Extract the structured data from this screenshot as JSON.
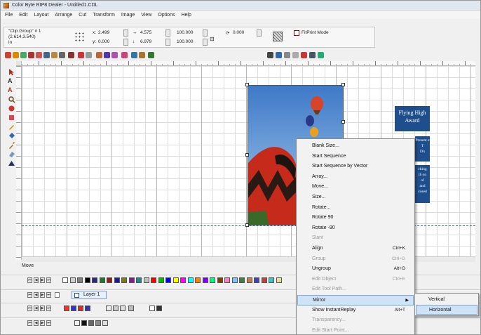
{
  "window": {
    "title": "Color Byte RIP8 Dealer - Untitled1.CDL"
  },
  "menu": [
    "File",
    "Edit",
    "Layout",
    "Arrange",
    "Cut",
    "Transform",
    "Image",
    "View",
    "Options",
    "Help"
  ],
  "properties": {
    "object_name": "\"Clip Group\" # 1",
    "coords": "(2.614,3.540)",
    "units": "in",
    "x_label": "x:",
    "x_value": "2.499",
    "y_label": "y:",
    "y_value": "0.000",
    "width_value": "4.575",
    "height_value": "6.979",
    "scale_w": "100.000",
    "scale_h": "100.000",
    "rotation": "0.000",
    "fitprint_label": "FitPrint Mode"
  },
  "status": {
    "text": "Move"
  },
  "layer": {
    "name": "Layer 1"
  },
  "award": {
    "title": "Flying High Award",
    "text_lines": [
      "Present e",
      "T",
      "D's",
      "cking",
      "th on",
      "of",
      "and",
      "cosed"
    ]
  },
  "context_menu": {
    "items": [
      {
        "label": "Blank Size...",
        "shortcut": "",
        "enabled": true
      },
      {
        "label": "Start Sequence",
        "shortcut": "",
        "enabled": true
      },
      {
        "label": "Start Sequence by Vector",
        "shortcut": "",
        "enabled": true
      },
      {
        "label": "Array...",
        "shortcut": "",
        "enabled": true
      },
      {
        "label": "Move...",
        "shortcut": "",
        "enabled": true
      },
      {
        "label": "Size...",
        "shortcut": "",
        "enabled": true
      },
      {
        "label": "Rotate...",
        "shortcut": "",
        "enabled": true
      },
      {
        "label": "Rotate 90",
        "shortcut": "",
        "enabled": true
      },
      {
        "label": "Rotate -90",
        "shortcut": "",
        "enabled": true
      },
      {
        "label": "Slant",
        "shortcut": "",
        "enabled": false
      },
      {
        "label": "Align",
        "shortcut": "Ctrl+K",
        "enabled": true
      },
      {
        "label": "Group",
        "shortcut": "Ctrl+G",
        "enabled": false
      },
      {
        "label": "Ungroup",
        "shortcut": "Alt+G",
        "enabled": true
      },
      {
        "label": "Edit Object",
        "shortcut": "Ctrl+E",
        "enabled": false
      },
      {
        "label": "Edit Tool Path...",
        "shortcut": "",
        "enabled": false
      },
      {
        "label": "Mirror",
        "shortcut": "",
        "enabled": true,
        "submenu": true,
        "highlighted": true
      },
      {
        "label": "Show InstantReplay",
        "shortcut": "Alt+T",
        "enabled": true
      },
      {
        "label": "Transparency...",
        "shortcut": "",
        "enabled": false
      },
      {
        "label": "Edit Start Point...",
        "shortcut": "",
        "enabled": false
      }
    ]
  },
  "submenu": {
    "items": [
      {
        "label": "Vertical",
        "highlighted": false
      },
      {
        "label": "Horizontal",
        "highlighted": true
      }
    ]
  },
  "colors": {
    "palette": [
      "#ffffff",
      "#d0d0d0",
      "#808080",
      "#000000",
      "#2a2a7a",
      "#1a7a2a",
      "#9a1a1a",
      "#1a1a9a",
      "#7a7a1a",
      "#8a1a8a",
      "#1a8a8a",
      "#c0c0c0",
      "#ff0000",
      "#00c000",
      "#0000ff",
      "#ffff00",
      "#ff00ff",
      "#00ffff",
      "#ff8000",
      "#8000ff",
      "#00ff80",
      "#804000",
      "#ff80c0",
      "#80c0ff",
      "#408040",
      "#c08040",
      "#4040c0",
      "#c04040",
      "#40c0c0",
      "#e0e0a0"
    ],
    "accent": "#1e4f8c"
  },
  "icons": [
    "select-arrow-icon",
    "text-icon",
    "shape-icon",
    "zoom-icon",
    "fill-icon",
    "pen-icon",
    "eraser-icon",
    "layers-icon",
    "lock-icon"
  ]
}
